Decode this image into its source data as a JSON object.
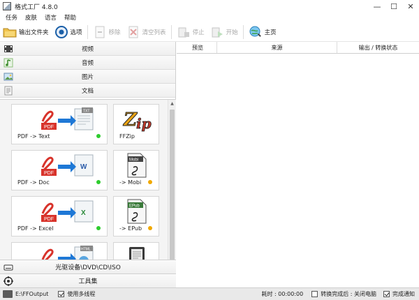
{
  "window": {
    "title": "格式工厂 4.8.0",
    "minimize": "—",
    "maximize": "☐",
    "close": "✕"
  },
  "menu": [
    "任务",
    "皮肤",
    "语言",
    "帮助"
  ],
  "toolbar": {
    "output_folder": "输出文件夹",
    "options": "选项",
    "remove": "移除",
    "clear_list": "清空列表",
    "stop": "停止",
    "start": "开始",
    "home": "主页"
  },
  "categories": {
    "video": "视频",
    "audio": "音频",
    "image": "图片",
    "document": "文档",
    "disc": "光驱设备\\DVD\\CD\\ISO",
    "tools": "工具集"
  },
  "tiles": [
    {
      "label": "PDF -> Text",
      "dot_color": "#2ecc2e"
    },
    {
      "label": "FFZip",
      "dot_color": ""
    },
    {
      "label": "PDF -> Doc",
      "dot_color": "#2ecc2e"
    },
    {
      "label": "-> Mobi",
      "dot_color": "#f0a800"
    },
    {
      "label": "PDF -> Excel",
      "dot_color": "#2ecc2e"
    },
    {
      "label": "-> EPub",
      "dot_color": "#f0a800"
    }
  ],
  "table": {
    "columns": [
      "预览",
      "来源",
      "输出 / 转换状态"
    ]
  },
  "status": {
    "output_path": "E:\\FFOutput",
    "multithread": "使用多线程",
    "elapsed": "耗时 : 00:00:00",
    "after_done": "转换完成后 : 关闭电脑",
    "notify": "完成通知"
  },
  "colors": {
    "pdf_red": "#d8332b",
    "arrow_blue": "#1e78d6",
    "dot_green": "#2ecc2e",
    "dot_orange": "#f0a800"
  }
}
